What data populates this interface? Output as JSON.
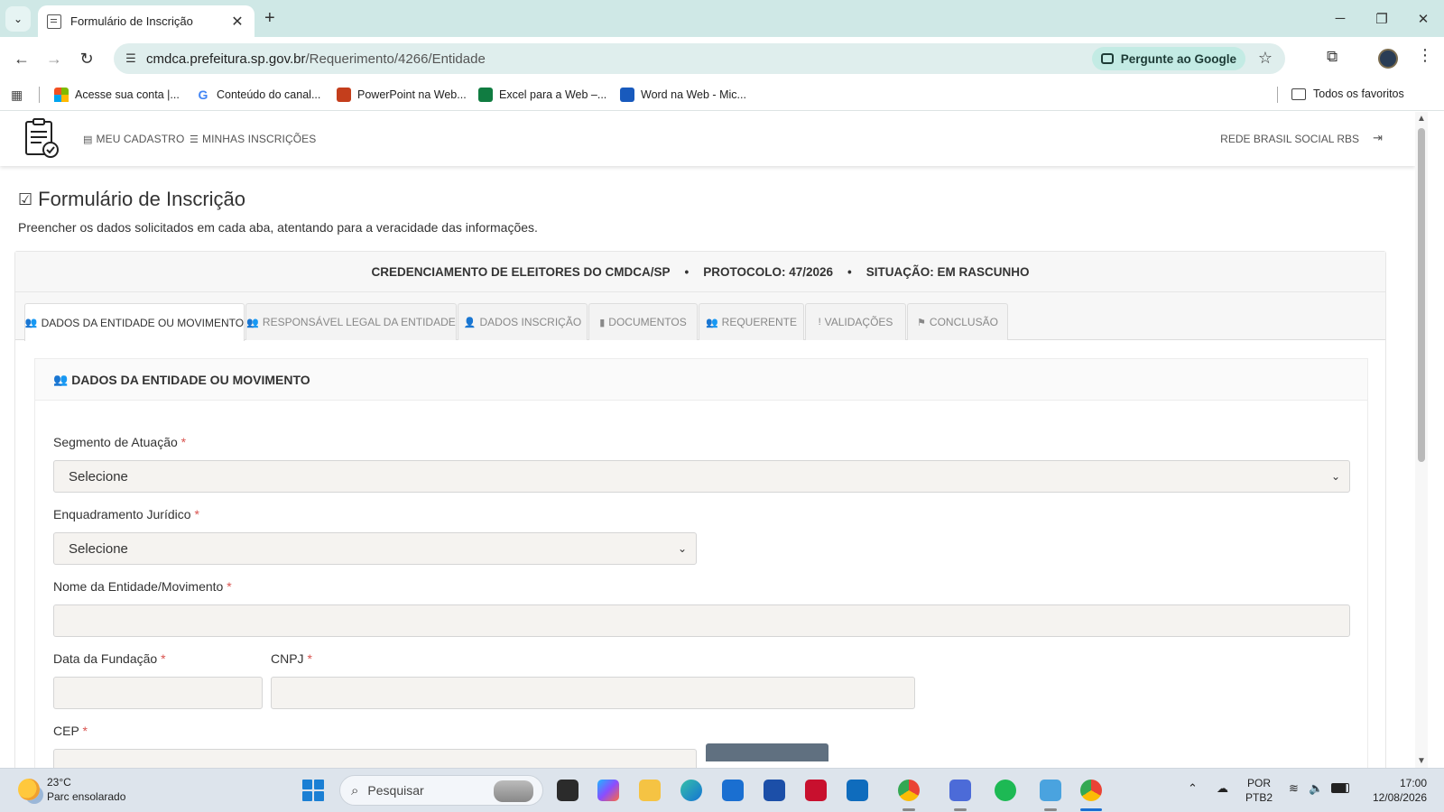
{
  "browser": {
    "tab_title": "Formulário de Inscrição",
    "url_host": "cmdca.prefeitura.sp.gov.br",
    "url_path": "/Requerimento/4266/Entidade",
    "ask_google": "Pergunte ao Google",
    "bookmarks": [
      {
        "label": "Acesse sua conta |...",
        "icon": "microsoft-icon"
      },
      {
        "label": "Conteúdo do canal...",
        "icon": "google-icon"
      },
      {
        "label": "PowerPoint na Web...",
        "icon": "powerpoint-icon"
      },
      {
        "label": "Excel para a Web –...",
        "icon": "excel-icon"
      },
      {
        "label": "Word na Web - Mic...",
        "icon": "word-icon"
      }
    ],
    "all_favorites": "Todos os favoritos"
  },
  "app_nav": {
    "meu_cadastro": "MEU CADASTRO",
    "minhas_inscricoes": "MINHAS INSCRIÇÕES",
    "user": "REDE BRASIL SOCIAL RBS"
  },
  "page": {
    "title": "Formulário de Inscrição",
    "subtitle": "Preencher os dados solicitados em cada aba, atentando para a veracidade das informações."
  },
  "header": {
    "credenciamento": "CREDENCIAMENTO DE ELEITORES DO CMDCA/SP",
    "protocolo": "PROTOCOLO: 47/2026",
    "situacao": "SITUAÇÃO: EM RASCUNHO",
    "separator": "•"
  },
  "tabs": [
    {
      "label": "DADOS DA ENTIDADE OU MOVIMENTO",
      "icon": "users-icon",
      "active": true
    },
    {
      "label": "RESPONSÁVEL LEGAL DA ENTIDADE",
      "icon": "users-icon",
      "active": false
    },
    {
      "label": "DADOS INSCRIÇÃO",
      "icon": "user-icon",
      "active": false
    },
    {
      "label": "DOCUMENTOS",
      "icon": "file-icon",
      "active": false
    },
    {
      "label": "REQUERENTE",
      "icon": "users-icon",
      "active": false
    },
    {
      "label": "VALIDAÇÕES",
      "icon": "exclamation-icon",
      "active": false
    },
    {
      "label": "CONCLUSÃO",
      "icon": "flag-icon",
      "active": false
    }
  ],
  "section": {
    "title": "DADOS DA ENTIDADE OU MOVIMENTO"
  },
  "form": {
    "required_mark": "*",
    "segmento_label": "Segmento de Atuação",
    "segmento_value": "Selecione",
    "enquadramento_label": "Enquadramento Jurídico",
    "enquadramento_value": "Selecione",
    "nome_label": "Nome da Entidade/Movimento",
    "nome_value": "",
    "data_fundacao_label": "Data da Fundação",
    "data_fundacao_value": "",
    "cnpj_label": "CNPJ",
    "cnpj_value": "",
    "cep_label": "CEP"
  },
  "taskbar": {
    "temperature": "23°C",
    "weather": "Parc ensolarado",
    "search_placeholder": "Pesquisar",
    "lang_1": "POR",
    "lang_2": "PTB2",
    "time": "17:00",
    "date": "12/08/2026"
  },
  "colors": {
    "tabstrip": "#cfe8e6",
    "omnibox": "#dfeeed",
    "required": "#d9534f",
    "input_bg": "#f5f3f0"
  }
}
